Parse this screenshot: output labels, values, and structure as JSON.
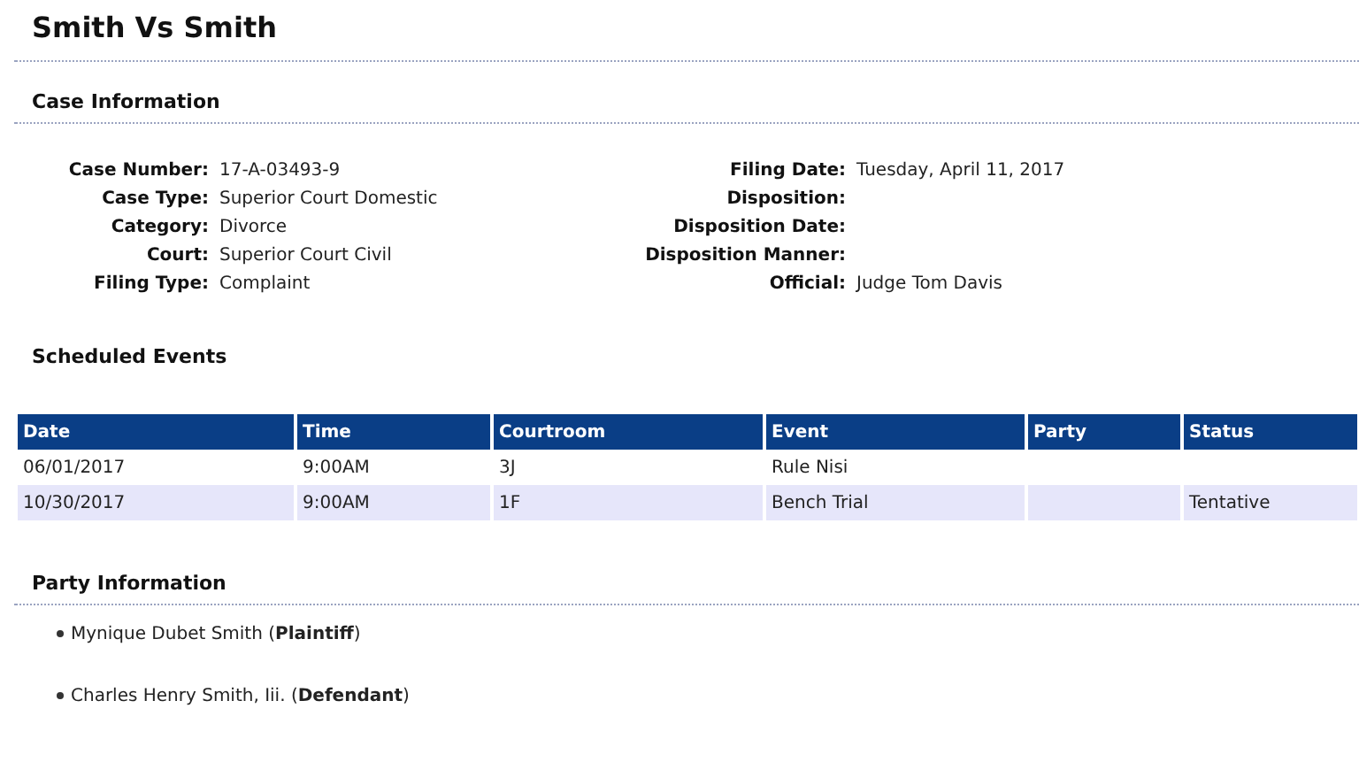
{
  "title": "Smith Vs Smith",
  "case_information": {
    "heading": "Case Information",
    "left_fields": [
      {
        "label": "Case Number:",
        "value": "17-A-03493-9"
      },
      {
        "label": "Case Type:",
        "value": "Superior Court Domestic"
      },
      {
        "label": "Category:",
        "value": "Divorce"
      },
      {
        "label": "Court:",
        "value": "Superior Court Civil"
      },
      {
        "label": "Filing Type:",
        "value": "Complaint"
      }
    ],
    "right_fields": [
      {
        "label": "Filing Date:",
        "value": "Tuesday, April 11, 2017"
      },
      {
        "label": "Disposition:"
      },
      {
        "label": "Disposition Date:"
      },
      {
        "label": "Disposition Manner:"
      },
      {
        "label": "Official:",
        "value": "Judge Tom Davis"
      }
    ]
  },
  "scheduled_events": {
    "heading": "Scheduled Events",
    "columns": [
      "Date",
      "Time",
      "Courtroom",
      "Event",
      "Party",
      "Status"
    ],
    "rows": [
      [
        "06/01/2017",
        "9:00AM",
        "3J",
        "Rule Nisi",
        "",
        ""
      ],
      [
        "10/30/2017",
        "9:00AM",
        "1F",
        "Bench Trial",
        "",
        "Tentative"
      ]
    ]
  },
  "party_information": {
    "heading": "Party Information",
    "parties": [
      "Mynique Dubet Smith (**Plaintiff**)",
      "Charles Henry Smith, Iii. (**Defendant**)"
    ]
  }
}
